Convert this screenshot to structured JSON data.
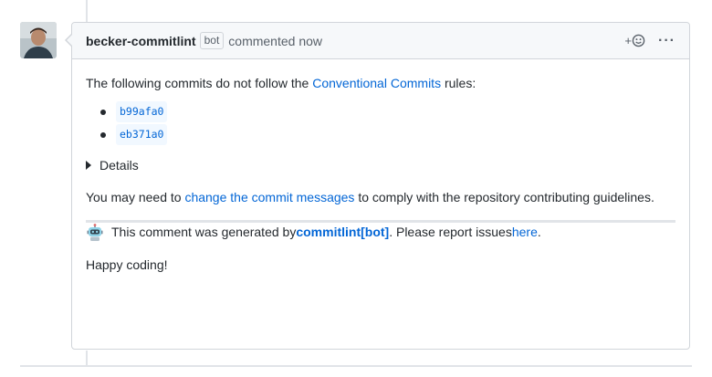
{
  "comment": {
    "author": "becker-commitlint",
    "author_badge": "bot",
    "timestamp_text": "commented now",
    "reaction_button_plus": "+",
    "more_options": "···"
  },
  "body": {
    "intro_prefix": "The following commits do not follow the ",
    "intro_link": "Conventional Commits",
    "intro_suffix": " rules:",
    "commits": [
      "b99afa0",
      "eb371a0"
    ],
    "details_label": "Details",
    "para2_prefix": "You may need to ",
    "para2_link": "change the commit messages",
    "para2_suffix": " to comply with the repository contributing guidelines.",
    "footer_prefix": " This comment was generated by ",
    "footer_bot_link": "commitlint[bot]",
    "footer_mid": ". Please report issues ",
    "footer_here_link": "here",
    "footer_end": ".",
    "closing": "Happy coding!"
  },
  "icons": {
    "avatar": "user-avatar",
    "reaction": "smiley-icon",
    "robot": "robot-icon"
  },
  "colors": {
    "link": "#0366d6",
    "header_bg": "#f6f8fa",
    "border": "#d1d5da"
  }
}
